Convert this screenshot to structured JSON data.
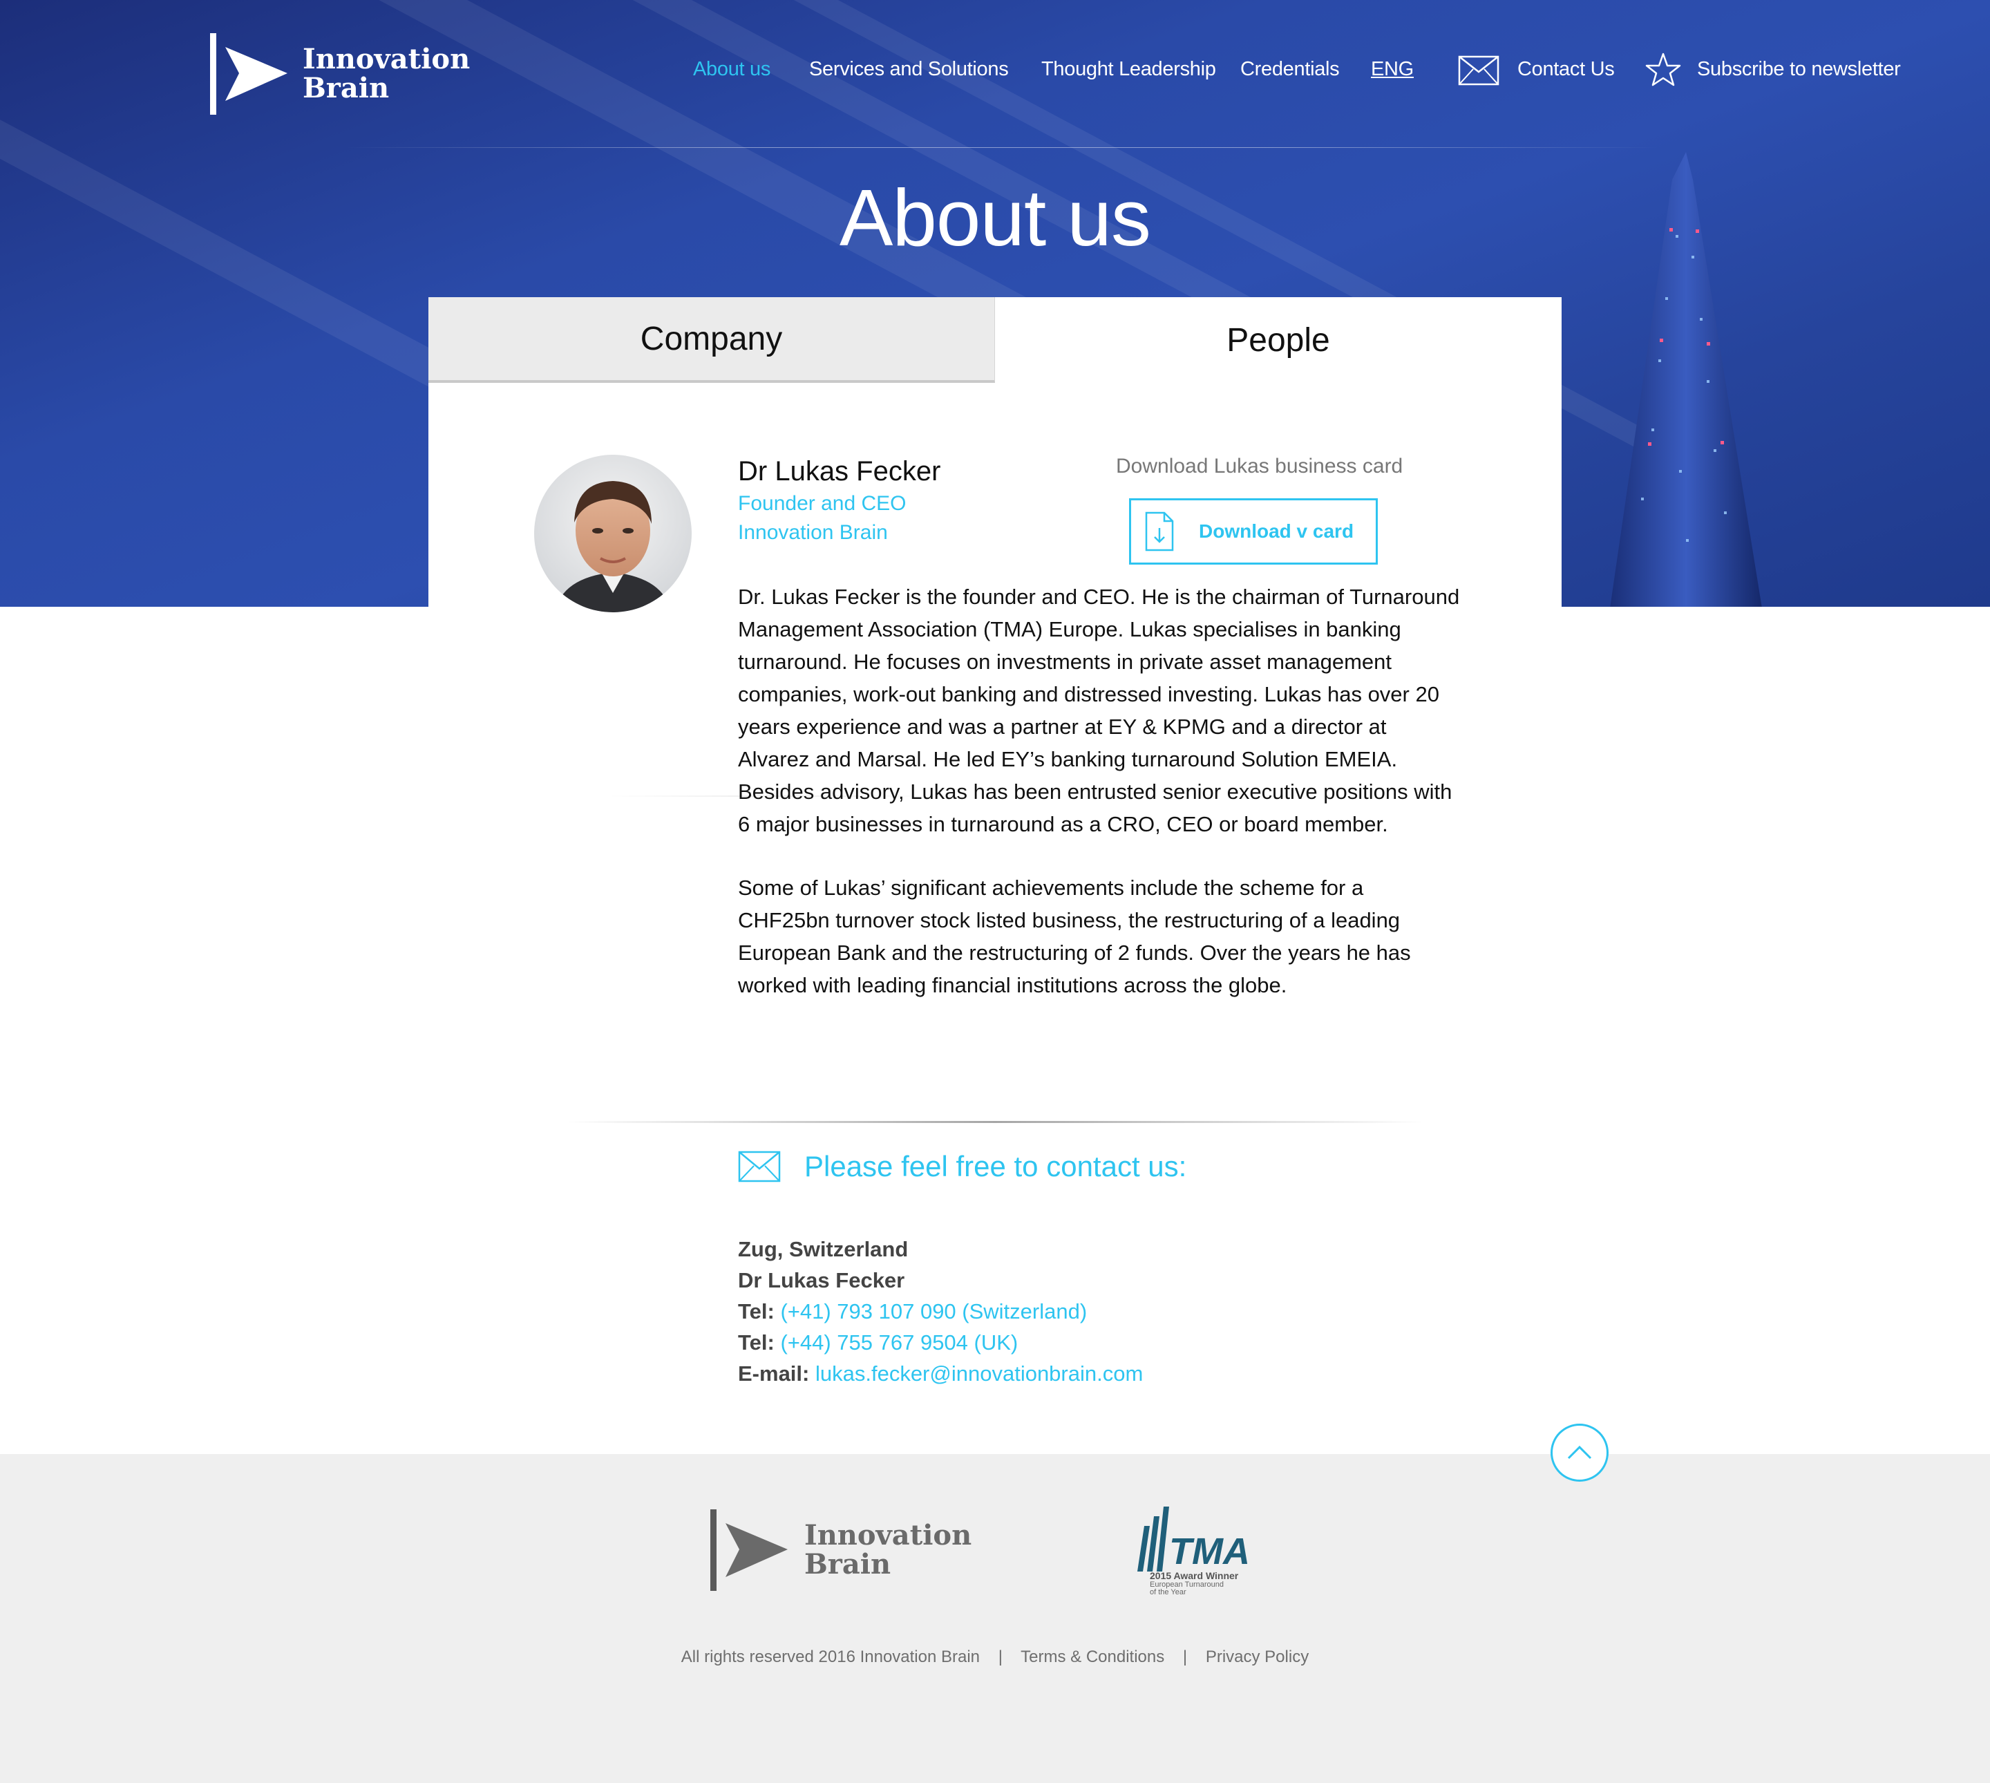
{
  "brand": {
    "name_line1": "Innovation",
    "name_line2": "Brain"
  },
  "nav": {
    "about": "About us",
    "services": "Services and Solutions",
    "thought": "Thought Leadership",
    "credentials": "Credentials",
    "language": "ENG",
    "contact": "Contact Us",
    "subscribe": "Subscribe to newsletter"
  },
  "page": {
    "title": "About us"
  },
  "tabs": {
    "company": "Company",
    "people": "People",
    "active": "People"
  },
  "person": {
    "name": "Dr Lukas Fecker",
    "role": "Founder and CEO",
    "company": "Innovation Brain",
    "vcard_caption": "Download Lukas business card",
    "vcard_button": "Download v card",
    "bio_1": "Dr. Lukas Fecker is the founder and CEO. He is the chairman of Turnaround Management Association (TMA) Europe. Lukas specialises in banking turnaround. He focuses on investments in private asset management companies, work-out banking and distressed investing. Lukas has over 20 years experience and was a partner at EY & KPMG and a director at Alvarez and Marsal. He led EY’s banking turnaround Solution EMEIA. Besides advisory, Lukas has been entrusted senior executive positions with 6 major businesses in turnaround as a CRO, CEO or board member.",
    "bio_2": "Some of Lukas’ significant achievements include the scheme for a CHF25bn turnover stock listed business, the restructuring of a leading European Bank and the restructuring of 2 funds. Over the years he has worked with leading financial institutions across the globe."
  },
  "contact": {
    "heading": "Please feel free to contact us:",
    "location": "Zug, Switzerland",
    "name": "Dr Lukas Fecker",
    "tel_label": "Tel:",
    "tel_ch": "(+41) 793 107 090 (Switzerland)",
    "tel_uk": "(+44) 755 767 9504 (UK)",
    "email_label": "E-mail:",
    "email": "lukas.fecker@innovationbrain.com"
  },
  "footer": {
    "tma_word": "TMA",
    "tma_award": "2015 Award Winner",
    "tma_sub1": "European Turnaround",
    "tma_sub2": "of the Year",
    "copyright": "All rights reserved 2016 Innovation Brain",
    "terms": "Terms & Conditions",
    "privacy": "Privacy Policy",
    "separator": "|"
  },
  "colors": {
    "accent": "#2ec4f0",
    "hero": "#2a4aa8",
    "footer_bg": "#efefef"
  },
  "icons": [
    "innovation-brain-logo",
    "mail-icon",
    "star-icon",
    "document-download-icon",
    "chevron-up-icon",
    "tma-logo"
  ]
}
